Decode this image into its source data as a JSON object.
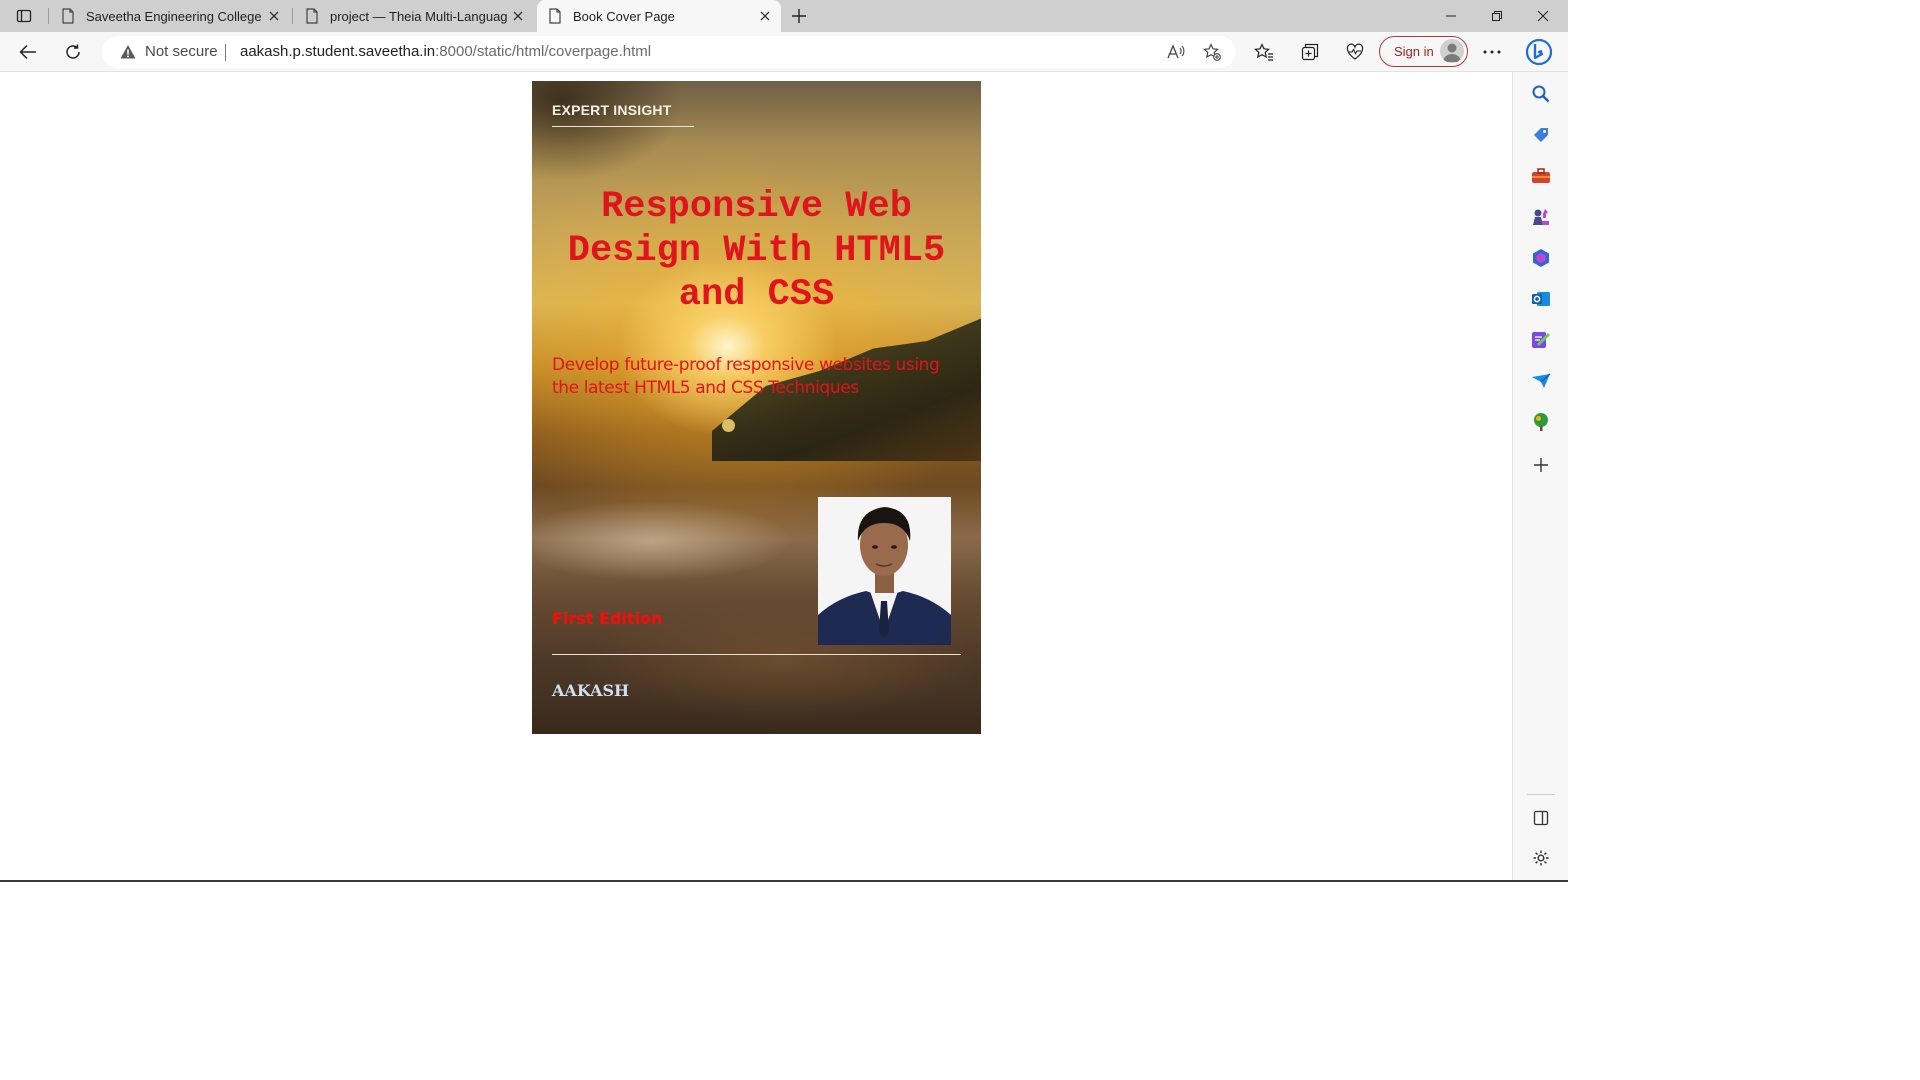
{
  "browser": {
    "tabs": [
      {
        "title": "Saveetha Engineering College",
        "active": false
      },
      {
        "title": "project — Theia Multi-Language",
        "active": false
      },
      {
        "title": "Book Cover Page",
        "active": true
      }
    ],
    "address": {
      "security_label": "Not secure",
      "url_host": "aakash.p.student.saveetha.in",
      "url_rest": ":8000/static/html/coverpage.html"
    },
    "signin_label": "Sign in",
    "accent_color": "#b03a3a"
  },
  "sidebar": {
    "items": [
      "search-icon",
      "shopping-tag-icon",
      "toolbox-icon",
      "games-icon",
      "office-icon",
      "outlook-icon",
      "designer-icon",
      "drop-icon",
      "tree-icon",
      "add-icon"
    ],
    "bottom_items": [
      "split-screen-icon",
      "settings-icon"
    ]
  },
  "cover": {
    "series_label": "EXPERT INSIGHT",
    "title_lines": [
      "Responsive Web",
      "Design With HTML5",
      "and CSS"
    ],
    "subtitle_lines": [
      "Develop future-proof responsive websites using",
      "the latest HTML5 and CSS Techniques"
    ],
    "edition": "First Edition",
    "author": "AAKASH",
    "title_color": "#e0141c"
  }
}
